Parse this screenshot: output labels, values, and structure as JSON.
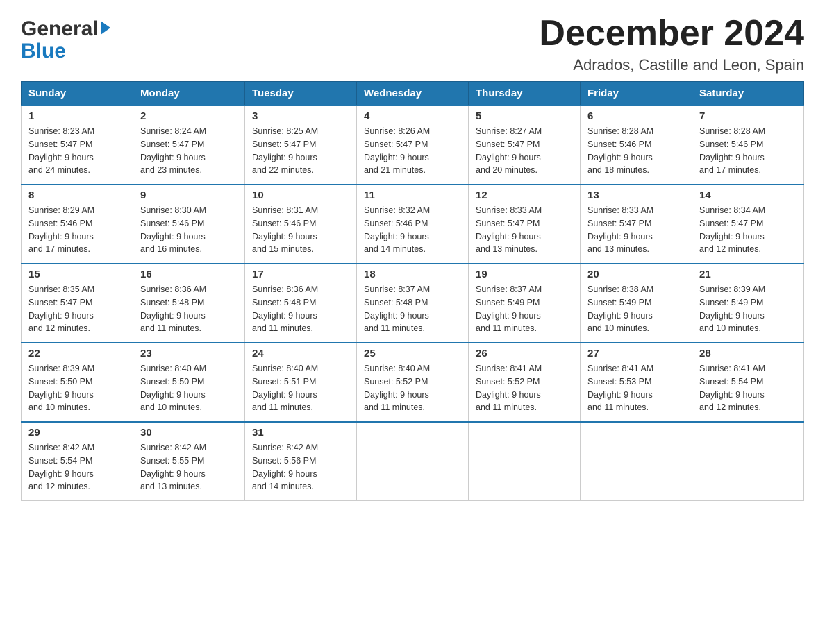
{
  "logo": {
    "general": "General",
    "blue": "Blue"
  },
  "title": "December 2024",
  "subtitle": "Adrados, Castille and Leon, Spain",
  "weekdays": [
    "Sunday",
    "Monday",
    "Tuesday",
    "Wednesday",
    "Thursday",
    "Friday",
    "Saturday"
  ],
  "weeks": [
    [
      {
        "day": "1",
        "sunrise": "8:23 AM",
        "sunset": "5:47 PM",
        "daylight": "9 hours and 24 minutes."
      },
      {
        "day": "2",
        "sunrise": "8:24 AM",
        "sunset": "5:47 PM",
        "daylight": "9 hours and 23 minutes."
      },
      {
        "day": "3",
        "sunrise": "8:25 AM",
        "sunset": "5:47 PM",
        "daylight": "9 hours and 22 minutes."
      },
      {
        "day": "4",
        "sunrise": "8:26 AM",
        "sunset": "5:47 PM",
        "daylight": "9 hours and 21 minutes."
      },
      {
        "day": "5",
        "sunrise": "8:27 AM",
        "sunset": "5:47 PM",
        "daylight": "9 hours and 20 minutes."
      },
      {
        "day": "6",
        "sunrise": "8:28 AM",
        "sunset": "5:46 PM",
        "daylight": "9 hours and 18 minutes."
      },
      {
        "day": "7",
        "sunrise": "8:28 AM",
        "sunset": "5:46 PM",
        "daylight": "9 hours and 17 minutes."
      }
    ],
    [
      {
        "day": "8",
        "sunrise": "8:29 AM",
        "sunset": "5:46 PM",
        "daylight": "9 hours and 17 minutes."
      },
      {
        "day": "9",
        "sunrise": "8:30 AM",
        "sunset": "5:46 PM",
        "daylight": "9 hours and 16 minutes."
      },
      {
        "day": "10",
        "sunrise": "8:31 AM",
        "sunset": "5:46 PM",
        "daylight": "9 hours and 15 minutes."
      },
      {
        "day": "11",
        "sunrise": "8:32 AM",
        "sunset": "5:46 PM",
        "daylight": "9 hours and 14 minutes."
      },
      {
        "day": "12",
        "sunrise": "8:33 AM",
        "sunset": "5:47 PM",
        "daylight": "9 hours and 13 minutes."
      },
      {
        "day": "13",
        "sunrise": "8:33 AM",
        "sunset": "5:47 PM",
        "daylight": "9 hours and 13 minutes."
      },
      {
        "day": "14",
        "sunrise": "8:34 AM",
        "sunset": "5:47 PM",
        "daylight": "9 hours and 12 minutes."
      }
    ],
    [
      {
        "day": "15",
        "sunrise": "8:35 AM",
        "sunset": "5:47 PM",
        "daylight": "9 hours and 12 minutes."
      },
      {
        "day": "16",
        "sunrise": "8:36 AM",
        "sunset": "5:48 PM",
        "daylight": "9 hours and 11 minutes."
      },
      {
        "day": "17",
        "sunrise": "8:36 AM",
        "sunset": "5:48 PM",
        "daylight": "9 hours and 11 minutes."
      },
      {
        "day": "18",
        "sunrise": "8:37 AM",
        "sunset": "5:48 PM",
        "daylight": "9 hours and 11 minutes."
      },
      {
        "day": "19",
        "sunrise": "8:37 AM",
        "sunset": "5:49 PM",
        "daylight": "9 hours and 11 minutes."
      },
      {
        "day": "20",
        "sunrise": "8:38 AM",
        "sunset": "5:49 PM",
        "daylight": "9 hours and 10 minutes."
      },
      {
        "day": "21",
        "sunrise": "8:39 AM",
        "sunset": "5:49 PM",
        "daylight": "9 hours and 10 minutes."
      }
    ],
    [
      {
        "day": "22",
        "sunrise": "8:39 AM",
        "sunset": "5:50 PM",
        "daylight": "9 hours and 10 minutes."
      },
      {
        "day": "23",
        "sunrise": "8:40 AM",
        "sunset": "5:50 PM",
        "daylight": "9 hours and 10 minutes."
      },
      {
        "day": "24",
        "sunrise": "8:40 AM",
        "sunset": "5:51 PM",
        "daylight": "9 hours and 11 minutes."
      },
      {
        "day": "25",
        "sunrise": "8:40 AM",
        "sunset": "5:52 PM",
        "daylight": "9 hours and 11 minutes."
      },
      {
        "day": "26",
        "sunrise": "8:41 AM",
        "sunset": "5:52 PM",
        "daylight": "9 hours and 11 minutes."
      },
      {
        "day": "27",
        "sunrise": "8:41 AM",
        "sunset": "5:53 PM",
        "daylight": "9 hours and 11 minutes."
      },
      {
        "day": "28",
        "sunrise": "8:41 AM",
        "sunset": "5:54 PM",
        "daylight": "9 hours and 12 minutes."
      }
    ],
    [
      {
        "day": "29",
        "sunrise": "8:42 AM",
        "sunset": "5:54 PM",
        "daylight": "9 hours and 12 minutes."
      },
      {
        "day": "30",
        "sunrise": "8:42 AM",
        "sunset": "5:55 PM",
        "daylight": "9 hours and 13 minutes."
      },
      {
        "day": "31",
        "sunrise": "8:42 AM",
        "sunset": "5:56 PM",
        "daylight": "9 hours and 14 minutes."
      },
      null,
      null,
      null,
      null
    ]
  ],
  "labels": {
    "sunrise": "Sunrise:",
    "sunset": "Sunset:",
    "daylight": "Daylight:"
  }
}
